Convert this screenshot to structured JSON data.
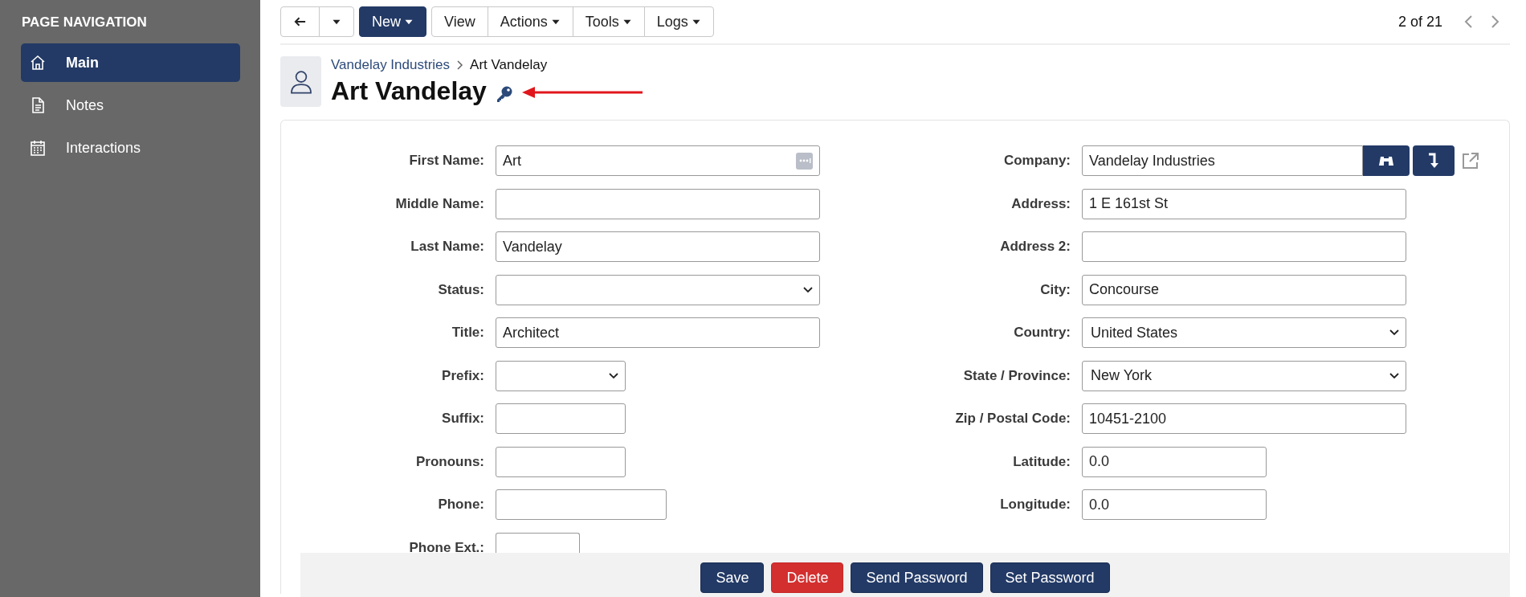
{
  "sidebar": {
    "heading": "PAGE NAVIGATION",
    "items": [
      {
        "label": "Main",
        "selected": true
      },
      {
        "label": "Notes",
        "selected": false
      },
      {
        "label": "Interactions",
        "selected": false
      }
    ]
  },
  "toolbar": {
    "buttons": [
      {
        "kind": "back",
        "primary": false,
        "has_menu": false
      },
      {
        "kind": "menu",
        "primary": false,
        "has_menu": true
      },
      {
        "kind": "text",
        "label": "New",
        "primary": true,
        "has_menu": true
      },
      {
        "kind": "text",
        "label": "View",
        "primary": false,
        "has_menu": false
      },
      {
        "kind": "text",
        "label": "Actions",
        "primary": false,
        "has_menu": true
      },
      {
        "kind": "text",
        "label": "Tools",
        "primary": false,
        "has_menu": true
      },
      {
        "kind": "text",
        "label": "Logs",
        "primary": false,
        "has_menu": true
      }
    ]
  },
  "pager": {
    "text": "2 of 21"
  },
  "breadcrumb": [
    {
      "label": "Vandelay Industries",
      "link": true
    },
    {
      "label": "Art Vandelay",
      "link": false
    }
  ],
  "title": "Art Vandelay",
  "form": {
    "left": [
      {
        "label": "First Name:",
        "kind": "autofill",
        "value": "Art"
      },
      {
        "label": "Middle Name:",
        "kind": "text"
      },
      {
        "label": "Last Name:",
        "kind": "text",
        "value": "Vandelay"
      },
      {
        "label": "Status:",
        "kind": "select"
      },
      {
        "label": "Title:",
        "kind": "text",
        "value": "Architect"
      },
      {
        "label": "Prefix:",
        "kind": "select"
      },
      {
        "label": "Suffix:",
        "kind": "text"
      },
      {
        "label": "Pronouns:",
        "kind": "text"
      },
      {
        "label": "Phone:",
        "kind": "text"
      },
      {
        "label": "Phone Ext.:",
        "kind": "text"
      }
    ],
    "right": [
      {
        "label": "Company:",
        "kind": "lookup",
        "value": "Vandelay Industries"
      },
      {
        "label": "Address:",
        "kind": "text",
        "value": "1 E 161st St"
      },
      {
        "label": "Address 2:",
        "kind": "text"
      },
      {
        "label": "City:",
        "kind": "text",
        "value": "Concourse"
      },
      {
        "label": "Country:",
        "kind": "select",
        "value": "United States"
      },
      {
        "label": "State / Province:",
        "kind": "select",
        "value": "New York"
      },
      {
        "label": "Zip / Postal Code:",
        "kind": "text",
        "value": "10451-2100"
      },
      {
        "label": "Latitude:",
        "kind": "text",
        "value": "0.0"
      },
      {
        "label": "Longitude:",
        "kind": "text",
        "value": "0.0"
      }
    ]
  },
  "footer_buttons": [
    {
      "label": "Save",
      "kind": "primary"
    },
    {
      "label": "Delete",
      "kind": "danger"
    },
    {
      "label": "Send Password",
      "kind": "primary"
    },
    {
      "label": "Set Password",
      "kind": "primary"
    }
  ]
}
